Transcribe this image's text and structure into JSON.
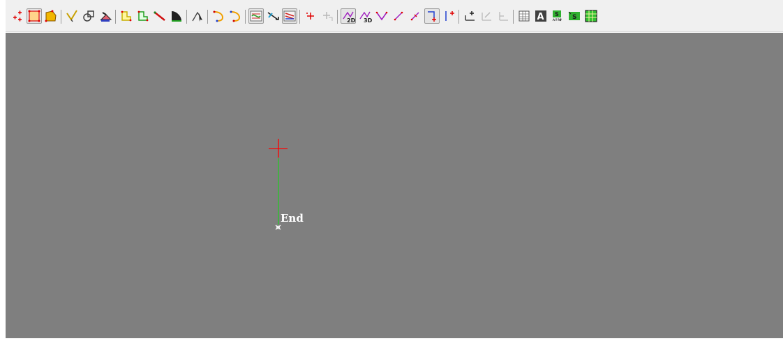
{
  "canvas": {
    "background": "#7f7f7f",
    "end_label": "End",
    "cursor_color": "#ff0000",
    "line_color": "#22cc22"
  },
  "toolbar": {
    "groups": [
      [
        "point-insert-icon",
        "polygon-select-icon",
        "polygon-fill-icon"
      ],
      [
        "cut-line-icon",
        "shape-merge-icon",
        "fill-bucket-icon"
      ],
      [
        "polyline-yellow-icon",
        "polyline-green-icon",
        "line-red-icon",
        "fill-shape-icon"
      ],
      [
        "cursor-select-icon"
      ],
      [
        "arc-forward-icon",
        "arc-reverse-icon"
      ],
      [
        "snap-toggle-icon",
        "arrow-swap-icon",
        "layer-toggle-icon"
      ],
      [
        "cross-add-icon",
        "cross-disabled-icon"
      ],
      [
        "mode-2d-icon",
        "mode-3d-icon",
        "vertex-v-icon",
        "slope-line-icon",
        "slope-line2-icon",
        "corner-add-icon",
        "vertical-add-icon"
      ],
      [
        "axis-add-icon",
        "axis-edit-disabled-icon",
        "axis-disabled-icon"
      ],
      [
        "table-icon",
        "text-a-icon",
        "attr-icon",
        "layer-s-icon",
        "grid-icon"
      ]
    ]
  }
}
